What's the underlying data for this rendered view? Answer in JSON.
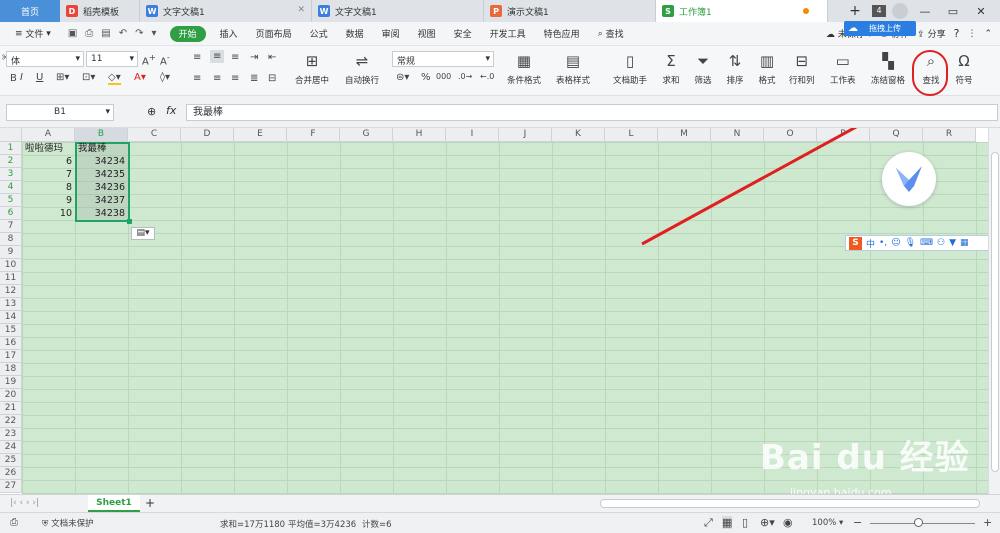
{
  "tabs": [
    {
      "label": "首页",
      "type": "home"
    },
    {
      "label": "稻壳模板",
      "icon_color": "#e8453c",
      "icon": "D"
    },
    {
      "label": "文字文稿1",
      "icon_color": "#3d7ee1",
      "icon": "W"
    },
    {
      "label": "文字文稿1",
      "icon_color": "#3d7ee1",
      "icon": "W"
    },
    {
      "label": "演示文稿1",
      "icon_color": "#e86a3a",
      "icon": "P"
    },
    {
      "label": "工作簿1",
      "icon_color": "#2f9e44",
      "icon": "S",
      "active": true
    }
  ],
  "tabbar_right": {
    "tab_count": "4",
    "add": "+"
  },
  "menubar": {
    "file": "文件",
    "items": [
      "开始",
      "插入",
      "页面布局",
      "公式",
      "数据",
      "审阅",
      "视图",
      "安全",
      "开发工具",
      "特色应用"
    ],
    "search": "查找",
    "unsaved": "未保存",
    "collab": "协作",
    "share": "分享",
    "cloud_upload": "拖拽上传",
    "help": "?"
  },
  "ribbon": {
    "font_name": "体",
    "font_size": "11",
    "number_format": "常规",
    "merge": "合并居中",
    "wrap": "自动换行",
    "cond_format": "条件格式",
    "table_style": "表格样式",
    "doc_helper": "文档助手",
    "sum": "求和",
    "filter": "筛选",
    "sort": "排序",
    "format": "格式",
    "rowcol": "行和列",
    "worksheet": "工作表",
    "freeze": "冻结窗格",
    "find": "查找",
    "symbol": "符号"
  },
  "formula": {
    "cell_ref": "B1",
    "fx": "fx",
    "content": "我最棒"
  },
  "columns": [
    "A",
    "B",
    "C",
    "D",
    "E",
    "F",
    "G",
    "H",
    "I",
    "J",
    "K",
    "L",
    "M",
    "N",
    "O",
    "P",
    "Q",
    "R"
  ],
  "rows": [
    "1",
    "2",
    "3",
    "4",
    "5",
    "6",
    "7",
    "8",
    "9",
    "10",
    "11",
    "12",
    "13",
    "14",
    "15",
    "16",
    "17",
    "18",
    "19",
    "20",
    "21",
    "22",
    "23",
    "24",
    "25",
    "26",
    "27"
  ],
  "cells": {
    "A1": "啦啦德玛",
    "B1": "我最棒",
    "A2": "6",
    "B2": "34234",
    "A3": "7",
    "B3": "34235",
    "A4": "8",
    "B4": "34236",
    "A5": "9",
    "B5": "34237",
    "A6": "10",
    "B6": "34238"
  },
  "sheet_tab": "Sheet1",
  "status": {
    "doc_protect": "文档未保护",
    "sum": "求和=17万1180",
    "avg": "平均值=3万4236",
    "count": "计数=6",
    "zoom": "100%"
  },
  "sogou_label": "中",
  "watermark": "Bai du 经验",
  "watermark_url": "jingyan.baidu.com",
  "colors": {
    "accent": "#2f9e44",
    "grid_bg": "#cfe8d0",
    "selection": "#21a366",
    "annotation": "#e02020"
  }
}
